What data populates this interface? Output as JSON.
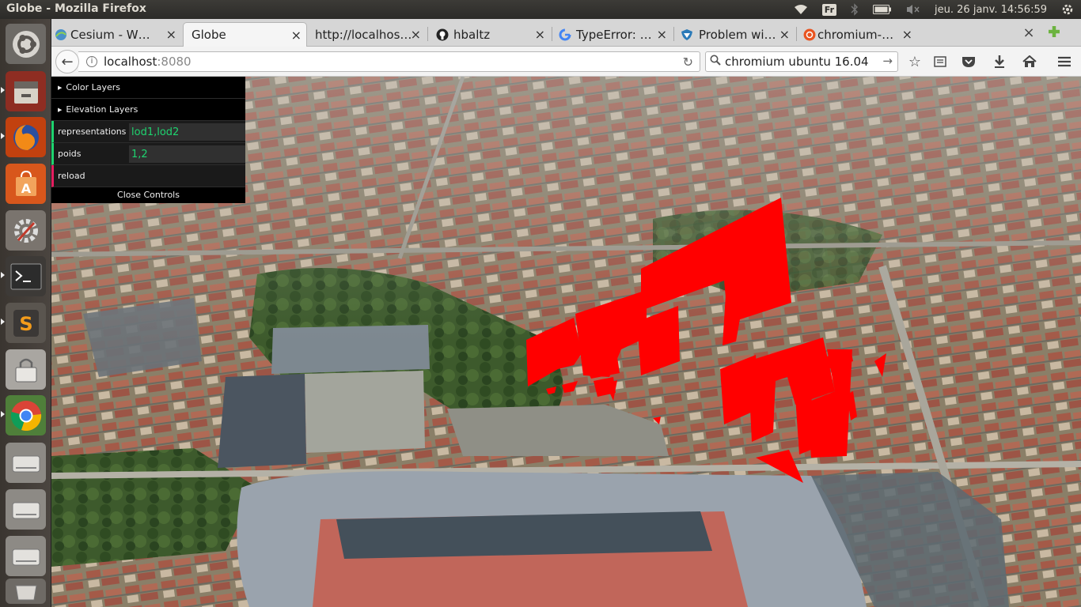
{
  "system": {
    "window_title": "Globe - Mozilla Firefox",
    "keyboard_layout": "Fr",
    "clock": "jeu. 26 janv. 14:56:59"
  },
  "launcher": {
    "items": [
      "ubuntu-dash",
      "files",
      "firefox",
      "software-center",
      "system-settings",
      "terminal",
      "sublime-text",
      "lock-screen",
      "chromium",
      "drive-1",
      "drive-2",
      "drive-3",
      "trash"
    ]
  },
  "tabs": [
    {
      "title": "Cesium - W…",
      "favicon_color": "#4a90c9"
    },
    {
      "title": "Globe",
      "favicon_color": ""
    },
    {
      "title": "http://localhos…",
      "favicon_color": ""
    },
    {
      "title": "hbaltz",
      "favicon_color": "#222222"
    },
    {
      "title": "TypeError: …",
      "favicon_color": "#4285f4"
    },
    {
      "title": "Problem wi…",
      "favicon_color": "#2a7ab8"
    },
    {
      "title": "chromium-…",
      "favicon_color": "#e95420"
    }
  ],
  "navbar": {
    "url_host": "localhost",
    "url_port": ":8080",
    "search_value": "chromium ubuntu 16.04"
  },
  "gui": {
    "color_layers": "Color Layers",
    "elevation_layers": "Elevation Layers",
    "representations_label": "representations",
    "representations_value": "lod1,lod2",
    "poids_label": "poids",
    "poids_value": "1,2",
    "reload_label": "reload",
    "close_label": "Close Controls"
  },
  "colors": {
    "accent_string": "#1ed36f",
    "accent_function": "#e61d5f",
    "building_highlight": "#ff0000"
  }
}
